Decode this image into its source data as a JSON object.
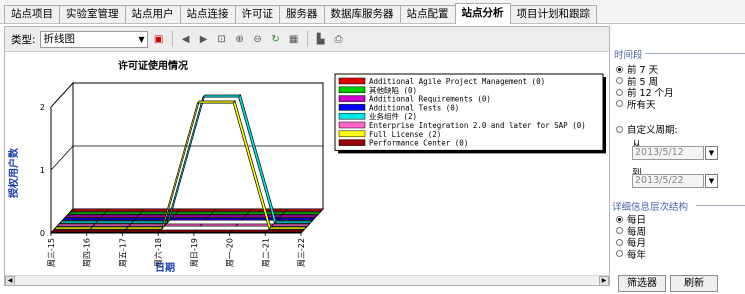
{
  "tabs": [
    "站点项目",
    "实验室管理",
    "站点用户",
    "站点连接",
    "许可证",
    "服务器",
    "数据库服务器",
    "站点配置",
    "站点分析",
    "项目计划和跟踪"
  ],
  "active_tab": "站点分析",
  "toolbar": {
    "type_label": "类型:",
    "type_value": "折线图",
    "icons": [
      "chart-settings-icon",
      "prev-icon",
      "next-icon",
      "zoom-fit-icon",
      "zoom-in-icon",
      "zoom-out-icon",
      "refresh-icon",
      "grid-icon",
      "chart-type-icon",
      "print-icon"
    ]
  },
  "chart_data": {
    "type": "line",
    "title": "许可证使用情况",
    "xlabel": "日期",
    "ylabel": "授权用户数",
    "categories": [
      "周三-15",
      "周四-16",
      "周五-17",
      "周六-18",
      "周日-19",
      "周一-20",
      "周二-21",
      "周三-22"
    ],
    "ylim": [
      0,
      2
    ],
    "yticks": [
      "0",
      "1",
      "2"
    ],
    "series": [
      {
        "name": "Additional Agile Project Management  (0)",
        "color": "#e00000",
        "values": [
          0,
          0,
          0,
          0,
          0,
          0,
          0,
          0
        ]
      },
      {
        "name": "其他缺陷  (0)",
        "color": "#00cc00",
        "values": [
          0,
          0,
          0,
          0,
          0,
          0,
          0,
          0
        ]
      },
      {
        "name": "Additional Requirements  (0)",
        "color": "#cc00cc",
        "values": [
          0,
          0,
          0,
          0,
          0,
          0,
          0,
          0
        ]
      },
      {
        "name": "Additional Tests  (0)",
        "color": "#0000ff",
        "values": [
          0,
          0,
          0,
          0,
          0,
          0,
          0,
          0
        ]
      },
      {
        "name": "业务组件  (2)",
        "color": "#00e5e5",
        "values": [
          0,
          0,
          0,
          0,
          2,
          2,
          0,
          0
        ]
      },
      {
        "name": "Enterprise Integration 2.0 and later for SAP  (0)",
        "color": "#ff66cc",
        "values": [
          0,
          0,
          0,
          0,
          0,
          0,
          0,
          0
        ]
      },
      {
        "name": "Full License  (2)",
        "color": "#ffff00",
        "values": [
          0,
          0,
          0,
          0,
          2,
          2,
          0,
          0
        ]
      },
      {
        "name": "Performance Center  (0)",
        "color": "#990000",
        "values": [
          0,
          0,
          0,
          0,
          0,
          0,
          0,
          0
        ]
      }
    ]
  },
  "side": {
    "period_title": "时间段",
    "period_options": [
      "前 7 天",
      "前 5 周",
      "前 12 个月",
      "所有天"
    ],
    "period_selected": 0,
    "custom_label": "自定义周期:",
    "from_label": "从",
    "from_value": "2013/5/12",
    "to_label": "到",
    "to_value": "2013/5/22",
    "detail_title": "详细信息层次结构",
    "detail_options": [
      "每日",
      "每周",
      "每月",
      "每年"
    ],
    "detail_selected": 0,
    "filter_button": "筛选器",
    "refresh_button": "刷新"
  }
}
